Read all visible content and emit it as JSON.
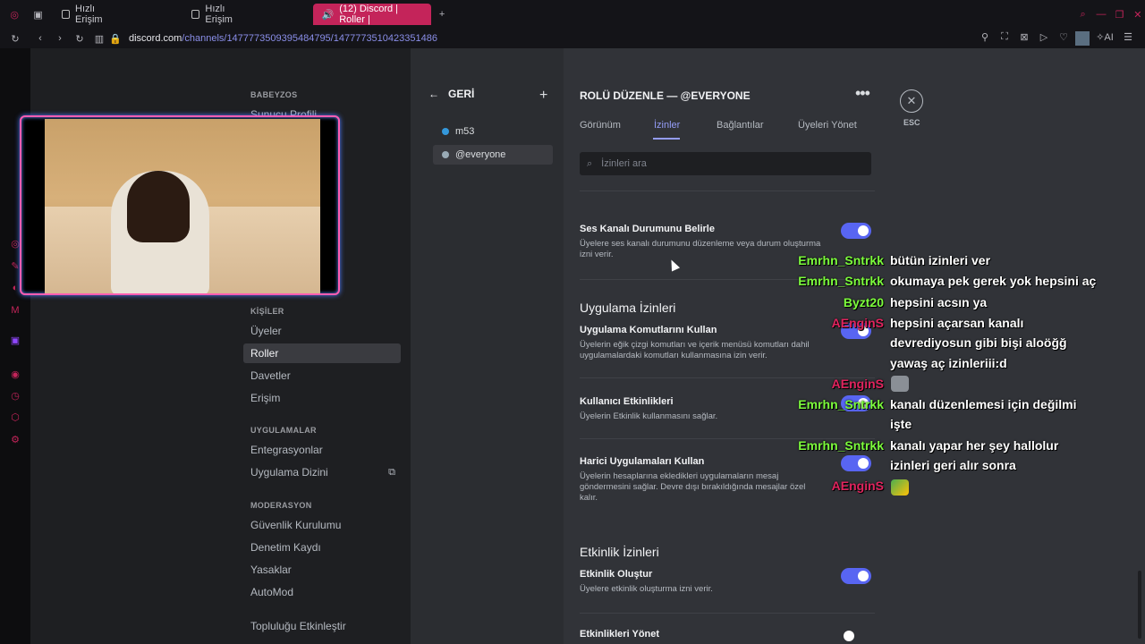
{
  "browser": {
    "tabs": [
      {
        "label": "Hızlı Erişim"
      },
      {
        "label": "Hızlı Erişim"
      },
      {
        "label": "(12) Discord | Roller | "
      }
    ],
    "url_host": "discord.com",
    "url_path": "/channels/1477773509395484795/1477773510423351486",
    "accent_color": "#c4245a"
  },
  "settings_nav": {
    "server_header": "BABEYZOS",
    "partial_item": "Sunucu Profili",
    "sections": [
      {
        "header": "KİŞİLER",
        "items": [
          "Üyeler",
          "Roller",
          "Davetler",
          "Erişim"
        ]
      },
      {
        "header": "UYGULAMALAR",
        "items": [
          "Entegrasyonlar",
          "Uygulama Dizini"
        ]
      },
      {
        "header": "MODERASYON",
        "items": [
          "Güvenlik Kurulumu",
          "Denetim Kaydı",
          "Yasaklar",
          "AutoMod"
        ]
      }
    ],
    "bottom_item": "Topluluğu Etkinleştir",
    "selected": "Roller"
  },
  "roles": {
    "back_label": "GERİ",
    "items": [
      {
        "name": "m53",
        "color": "#3498db"
      },
      {
        "name": "@everyone",
        "color": "#99aab5"
      }
    ]
  },
  "editor": {
    "title": "ROLÜ DÜZENLE — @EVERYONE",
    "tabs": [
      "Görünüm",
      "İzinler",
      "Bağlantılar",
      "Üyeleri Yönet"
    ],
    "active_tab": "İzinler",
    "search_placeholder": "İzinleri ara",
    "esc_label": "ESC",
    "permissions": [
      {
        "title": "Ses Kanalı Durumunu Belirle",
        "desc": "Üyelere ses kanalı durumunu düzenleme veya durum oluşturma izni verir.",
        "enabled": true
      },
      {
        "title": "Uygulama Komutlarını Kullan",
        "desc": "Üyelerin eğik çizgi komutları ve içerik menüsü komutları dahil uygulamalardaki komutları kullanmasına izin verir.",
        "enabled": true
      },
      {
        "title": "Kullanıcı Etkinlikleri",
        "desc": "Üyelerin Etkinlik kullanmasını sağlar.",
        "enabled": true
      },
      {
        "title": "Harici Uygulamaları Kullan",
        "desc": "Üyelerin hesaplarına ekledikleri uygulamaların mesaj göndermesini sağlar. Devre dışı bırakıldığında mesajlar özel kalır.",
        "enabled": true
      },
      {
        "title": "Etkinlik Oluştur",
        "desc": "Üyelere etkinlik oluşturma izni verir.",
        "enabled": true
      },
      {
        "title": "Etkinlikleri Yönet",
        "desc": "",
        "enabled": false
      }
    ],
    "section_headings": [
      "Uygulama İzinleri",
      "Etkinlik İzinleri"
    ],
    "toggle_on_color": "#5865f2"
  },
  "chat": [
    {
      "user": "Emrhn_Sntrkk",
      "color": "#7cfc3c",
      "lines": [
        "bütün izinleri ver"
      ]
    },
    {
      "user": "Emrhn_Sntrkk",
      "color": "#7cfc3c",
      "lines": [
        "okumaya pek gerek yok hepsini aç"
      ]
    },
    {
      "user": "Byzt20",
      "color": "#7cfc3c",
      "lines": [
        "hepsini acsın ya"
      ]
    },
    {
      "user": "AEnginS",
      "color": "#e0245e",
      "lines": [
        "hepsini açarsan kanalı",
        "devrediyosun gibi bişi aloöğğ",
        "yawaş aç izinleriii:d"
      ]
    },
    {
      "user": "AEnginS",
      "color": "#e0245e",
      "lines": []
    },
    {
      "user": "Emrhn_Sntrkk",
      "color": "#7cfc3c",
      "lines": [
        "kanalı düzenlemesi için değilmi",
        "işte"
      ]
    },
    {
      "user": "Emrhn_Sntrkk",
      "color": "#7cfc3c",
      "lines": [
        "kanalı yapar her şey hallolur",
        "izinleri geri alır sonra"
      ]
    },
    {
      "user": "AEnginS",
      "color": "#e0245e",
      "lines": []
    }
  ]
}
